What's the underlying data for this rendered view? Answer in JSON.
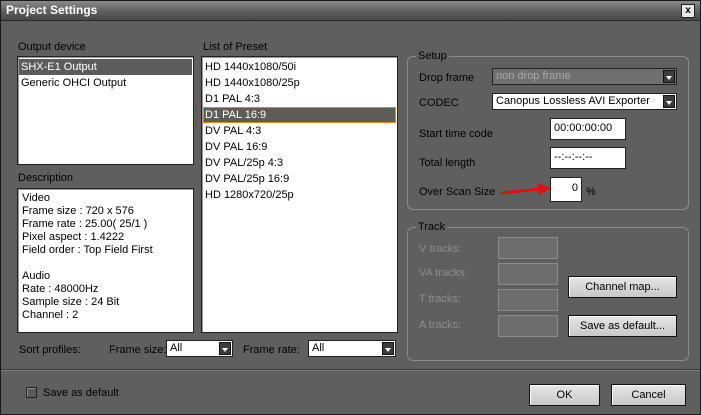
{
  "window": {
    "title": "Project Settings",
    "close_glyph": "x"
  },
  "output_device": {
    "label": "Output device",
    "items": [
      "SHX-E1 Output",
      "Generic OHCI Output"
    ],
    "selected_index": 0
  },
  "preset": {
    "label": "List of Preset",
    "items": [
      "HD 1440x1080/50i",
      "HD 1440x1080/25p",
      "D1 PAL 4:3",
      "D1 PAL 16:9",
      "DV PAL 4:3",
      "DV PAL 16:9",
      "DV PAL/25p 4:3",
      "DV PAL/25p 16:9",
      "HD 1280x720/25p"
    ],
    "selected_index": 3
  },
  "description": {
    "label": "Description",
    "lines": [
      "Video",
      "Frame size : 720 x 576",
      "Frame rate : 25.00( 25/1 )",
      "Pixel aspect : 1.4222",
      "Field order : Top Field First",
      "",
      "Audio",
      "Rate : 48000Hz",
      "Sample size : 24 Bit",
      "Channel : 2"
    ]
  },
  "sort": {
    "label": "Sort profiles:",
    "frame_size_label": "Frame size:",
    "frame_size_value": "All",
    "frame_rate_label": "Frame rate:",
    "frame_rate_value": "All"
  },
  "setup": {
    "title": "Setup",
    "drop_frame_label": "Drop frame",
    "drop_frame_value": "non drop frame",
    "codec_label": "CODEC",
    "codec_value": "Canopus Lossless AVI Exporter",
    "start_tc_label": "Start time code",
    "start_tc_value": "00:00:00:00",
    "total_length_label": "Total length",
    "total_length_value": "--:--:--:--",
    "overscan_label": "Over Scan Size",
    "overscan_value": "0",
    "overscan_unit": "%"
  },
  "track": {
    "title": "Track",
    "v_label": "V tracks:",
    "va_label": "VA tracks:",
    "t_label": "T tracks:",
    "a_label": "A tracks:",
    "channel_map_label": "Channel map...",
    "save_default_label": "Save as default..."
  },
  "footer": {
    "save_default_checkbox_label": "Save as default",
    "save_default_checked": false,
    "ok_label": "OK",
    "cancel_label": "Cancel"
  },
  "colors": {
    "selection": "#5c5c5c",
    "selection_outline": "#e08a1e",
    "annotation_arrow": "#e01010"
  }
}
